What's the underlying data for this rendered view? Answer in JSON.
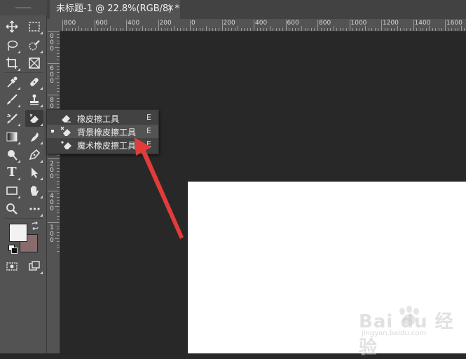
{
  "document_tab": {
    "title": "未标题-1 @ 22.8%(RGB/8) *",
    "close": "×"
  },
  "ruler_h_labels": [
    "800",
    "600",
    "400",
    "200",
    "0",
    "200",
    "400",
    "600",
    "800",
    "1000",
    "1200",
    "1400",
    "1600"
  ],
  "ruler_v_labels": [
    "0 0 0",
    "6 0 0",
    "8 0 0",
    "0 0",
    "2 0 0",
    "4 0 0",
    "1 0 0"
  ],
  "tools": {
    "move": "move-tool",
    "marquee": "marquee-tool",
    "lasso": "lasso-tool",
    "quick-select": "quick-selection-tool",
    "crop": "crop-tool",
    "frame": "frame-tool",
    "eyedropper": "eyedropper-tool",
    "healing": "healing-brush-tool",
    "brush": "brush-tool",
    "stamp": "clone-stamp-tool",
    "history-brush": "history-brush-tool",
    "eraser": "eraser-tool",
    "gradient": "gradient-tool",
    "smudge": "smudge-tool",
    "dodge": "dodge-tool",
    "pen": "pen-tool",
    "type_label": "T",
    "path-select": "path-selection-tool",
    "shape": "rectangle-tool",
    "hand": "hand-tool",
    "zoom": "zoom-tool",
    "more_label": "•••"
  },
  "colors": {
    "foreground": "#f2f2f2",
    "background": "#8a6b6b",
    "accent_arrow": "#e23b3b"
  },
  "flyout": {
    "items": [
      {
        "label": "橡皮擦工具",
        "key": "E",
        "icon": "eraser-icon",
        "selected": false
      },
      {
        "label": "背景橡皮擦工具",
        "key": "E",
        "icon": "background-eraser-icon",
        "selected": true
      },
      {
        "label": "魔术橡皮擦工具",
        "key": "E",
        "icon": "magic-eraser-icon",
        "selected": false
      }
    ]
  },
  "watermark": {
    "text": "Bai du 经验",
    "url": "jingyan.baidu.com"
  }
}
